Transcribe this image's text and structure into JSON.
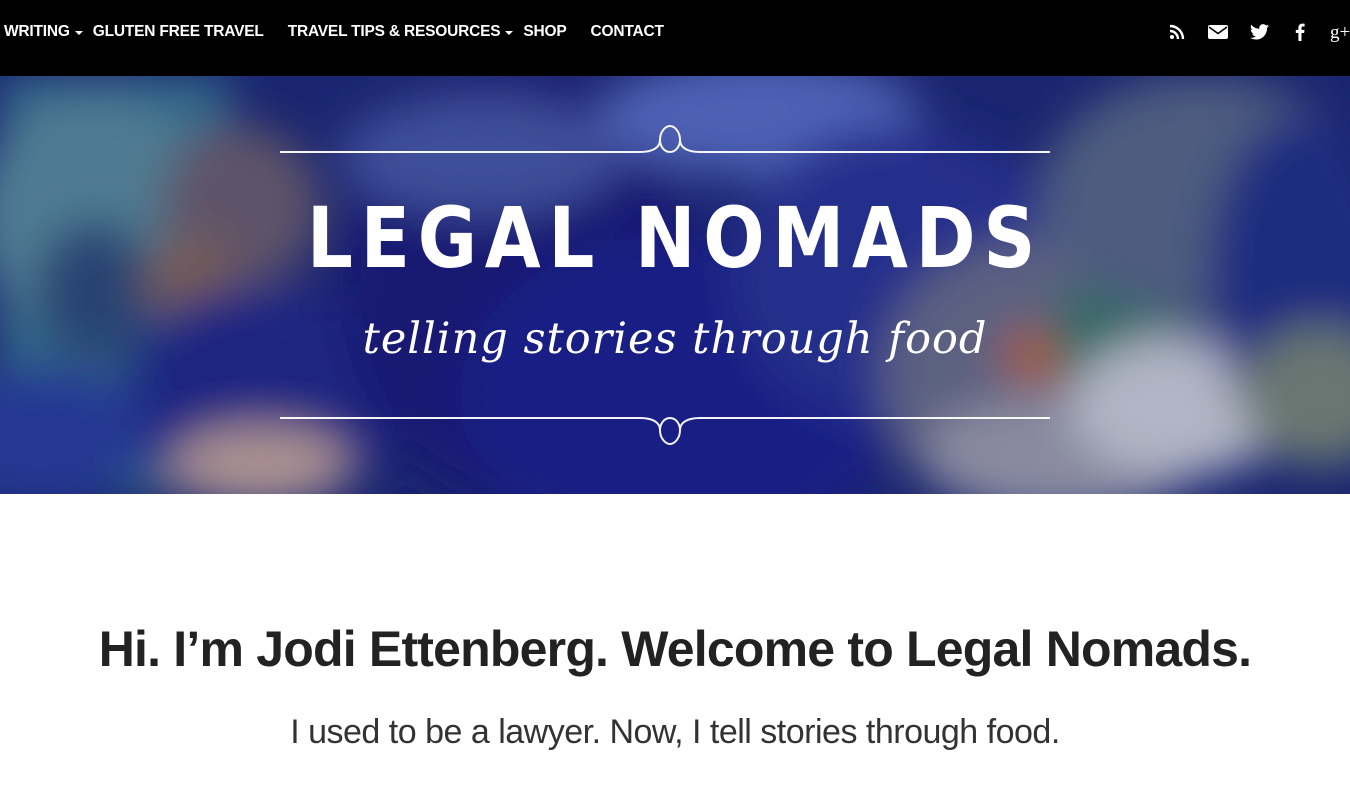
{
  "nav": {
    "items": [
      {
        "label": "Writing",
        "has_dropdown": true
      },
      {
        "label": "Gluten Free Travel",
        "has_dropdown": false
      },
      {
        "label": "Travel Tips & Resources",
        "has_dropdown": true
      },
      {
        "label": "Shop",
        "has_dropdown": false
      },
      {
        "label": "Contact",
        "has_dropdown": false
      }
    ],
    "social_icons": [
      "rss-icon",
      "envelope-icon",
      "twitter-icon",
      "facebook-icon",
      "google-plus-icon"
    ],
    "google_plus_glyph": "g+"
  },
  "hero": {
    "title": "LEGAL NOMADS",
    "tagline": "telling stories through food"
  },
  "intro": {
    "heading": "Hi. I’m Jodi Ettenberg. Welcome to Legal Nomads.",
    "subheading": "I used to be a lawyer. Now, I tell stories through food."
  },
  "colors": {
    "nav_background": "#000000",
    "hero_base": "#20246e",
    "text_dark": "#222222"
  }
}
